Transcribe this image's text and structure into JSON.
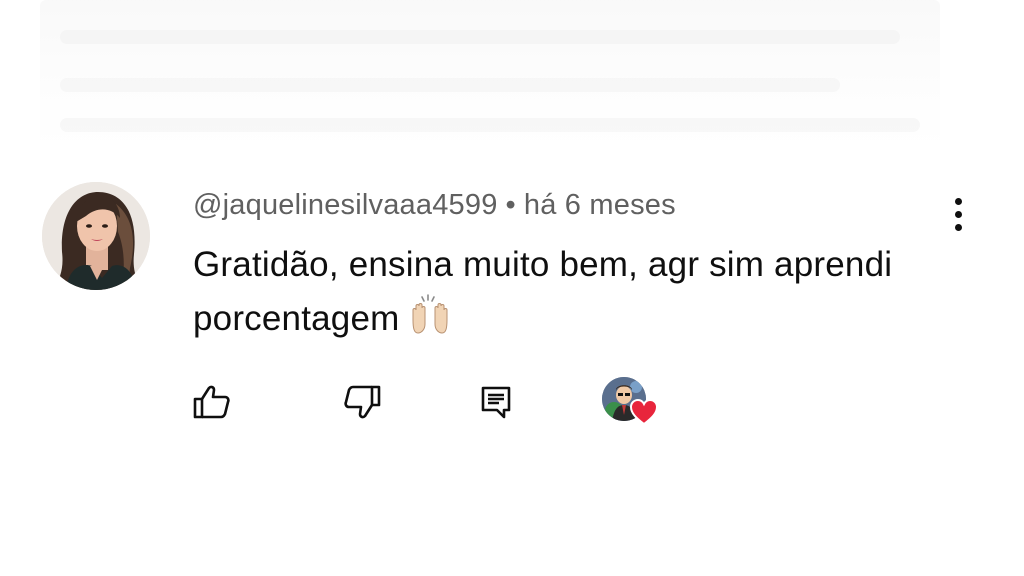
{
  "comment": {
    "author": "@jaquelinesilvaaa4599",
    "separator": "•",
    "time": "há 6 meses",
    "text": "Gratidão, ensina muito bem, agr sim aprendi porcentagem",
    "emoji": "🙌",
    "emoji_icon": "raising-hands-icon"
  },
  "actions": {
    "like_icon": "thumbs-up-icon",
    "dislike_icon": "thumbs-down-icon",
    "reply_icon": "comment-reply-icon",
    "creator_heart_icon": "creator-heart-icon",
    "more_icon": "more-vertical-icon"
  },
  "colors": {
    "text_primary": "#0f0f0f",
    "text_secondary": "#606060",
    "heart": "#e8253c",
    "background": "#ffffff"
  }
}
